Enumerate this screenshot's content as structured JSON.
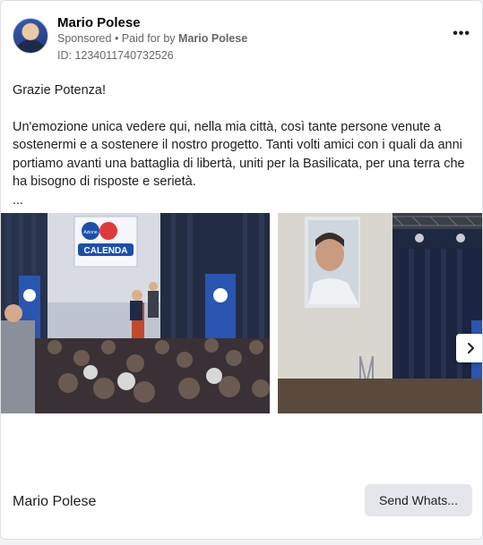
{
  "advertiser": {
    "name": "Mario Polese",
    "sponsored_label": "Sponsored",
    "paid_for_prefix": "• Paid for by",
    "paid_for_by": "Mario Polese",
    "id_line": "ID: 1234011740732526"
  },
  "menu_icon": "more-horizontal-icon",
  "post": {
    "greeting": "Grazie Potenza!",
    "paragraph": "Un'emozione unica vedere qui, nella mia città, così tante persone venute a sostenermi e a sostenere il nostro progetto. Tanti volti amici con i quali da anni portiamo avanti una battaglia di libertà, uniti per la Basilicata, per una terra che ha bisogno di risposte e serietà.",
    "ellipsis": "..."
  },
  "carousel": {
    "slide1": {
      "banner_brand": "Azione",
      "banner_name": "CALENDA"
    },
    "next_icon": "chevron-right-icon"
  },
  "footer": {
    "page_name": "Mario Polese",
    "cta_label": "Send Whats..."
  },
  "colors": {
    "card_bg": "#ffffff",
    "meta_text": "#65676b",
    "cta_bg": "#e4e6eb",
    "azione_blue": "#1e4fa8"
  }
}
